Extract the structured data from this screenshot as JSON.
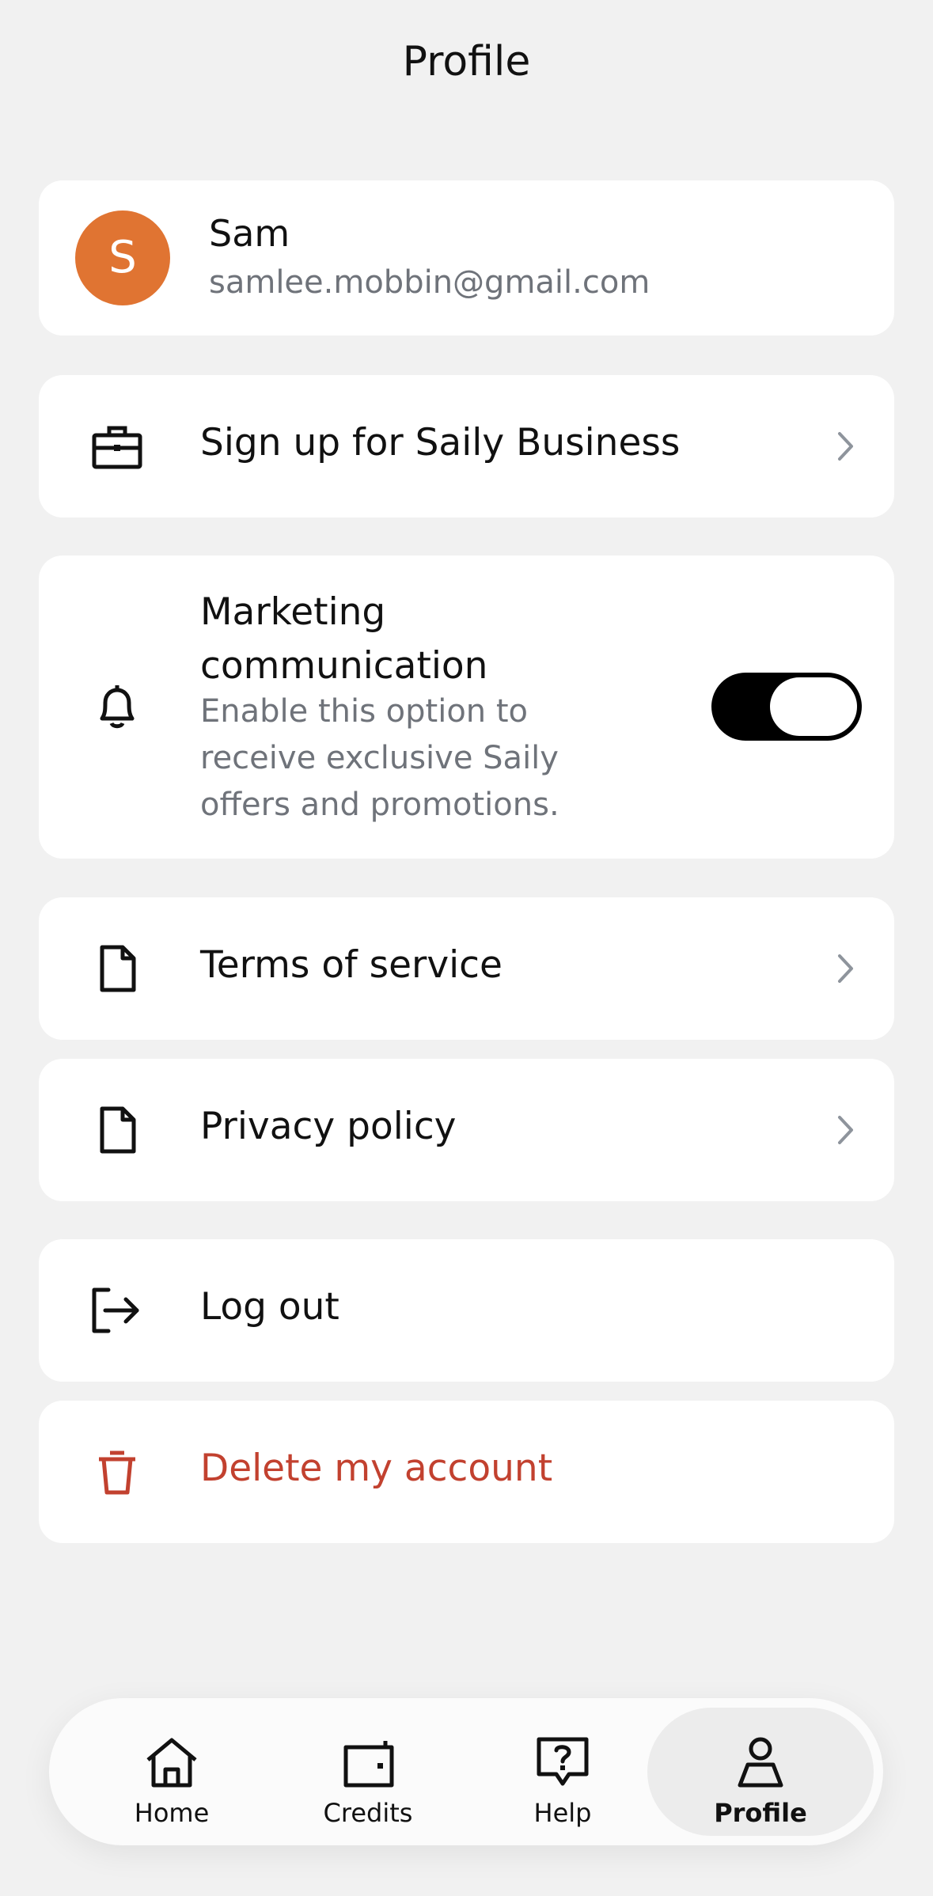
{
  "header": {
    "title": "Profile"
  },
  "user": {
    "avatar_initial": "S",
    "name": "Sam",
    "email": "samlee.mobbin@gmail.com",
    "avatar_color": "#e07432"
  },
  "menu": {
    "business": {
      "label": "Sign up for Saily Business",
      "icon": "briefcase-icon"
    },
    "marketing": {
      "title": "Marketing communication",
      "description": "Enable this option to receive exclusive Saily offers and promotions.",
      "icon": "bell-icon",
      "enabled": true
    },
    "terms": {
      "label": "Terms of service",
      "icon": "document-icon"
    },
    "privacy": {
      "label": "Privacy policy",
      "icon": "document-icon"
    },
    "logout": {
      "label": "Log out",
      "icon": "logout-icon"
    },
    "delete": {
      "label": "Delete my account",
      "icon": "trash-icon",
      "color": "#c2412f"
    }
  },
  "tabs": [
    {
      "label": "Home",
      "icon": "home-icon",
      "active": false
    },
    {
      "label": "Credits",
      "icon": "wallet-icon",
      "active": false
    },
    {
      "label": "Help",
      "icon": "help-icon",
      "active": false
    },
    {
      "label": "Profile",
      "icon": "person-icon",
      "active": true
    }
  ]
}
